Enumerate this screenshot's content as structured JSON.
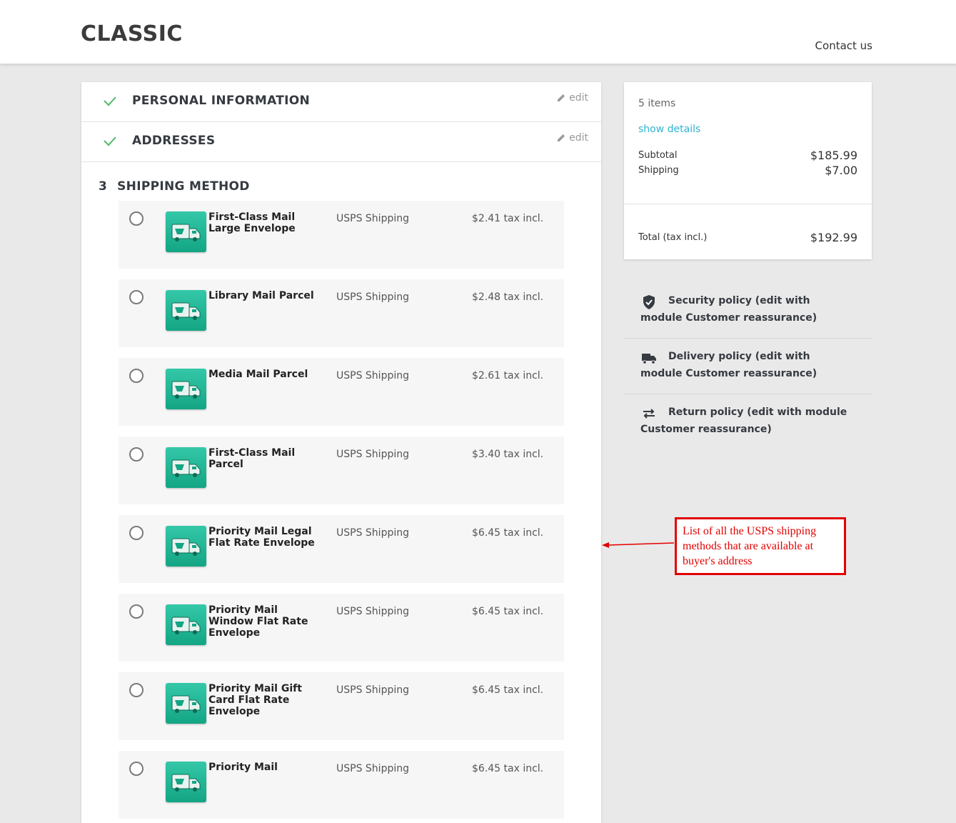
{
  "header": {
    "logo": "CLASSIC",
    "contact": "Contact us"
  },
  "steps": {
    "personal": {
      "title": "PERSONAL INFORMATION",
      "edit": "edit"
    },
    "addresses": {
      "title": "ADDRESSES",
      "edit": "edit"
    },
    "shipping": {
      "number": "3",
      "title": "SHIPPING METHOD"
    }
  },
  "shipping_options": [
    {
      "name": "First-Class Mail Large Envelope",
      "carrier": "USPS Shipping",
      "price": "$2.41 tax incl."
    },
    {
      "name": "Library Mail Parcel",
      "carrier": "USPS Shipping",
      "price": "$2.48 tax incl."
    },
    {
      "name": "Media Mail Parcel",
      "carrier": "USPS Shipping",
      "price": "$2.61 tax incl."
    },
    {
      "name": "First-Class Mail Parcel",
      "carrier": "USPS Shipping",
      "price": "$3.40 tax incl."
    },
    {
      "name": "Priority Mail Legal Flat Rate Envelope",
      "carrier": "USPS Shipping",
      "price": "$6.45 tax incl."
    },
    {
      "name": "Priority Mail Window Flat Rate Envelope",
      "carrier": "USPS Shipping",
      "price": "$6.45 tax incl."
    },
    {
      "name": "Priority Mail Gift Card Flat Rate Envelope",
      "carrier": "USPS Shipping",
      "price": "$6.45 tax incl."
    },
    {
      "name": "Priority Mail",
      "carrier": "USPS Shipping",
      "price": "$6.45 tax incl."
    }
  ],
  "summary": {
    "items": "5 items",
    "show_details": "show details",
    "subtotal_label": "Subtotal",
    "subtotal_value": "$185.99",
    "shipping_label": "Shipping",
    "shipping_value": "$7.00",
    "total_label": "Total (tax incl.)",
    "total_value": "$192.99"
  },
  "reassurance": [
    {
      "icon": "shield-check-icon",
      "text": "Security policy (edit with module Customer reassurance)"
    },
    {
      "icon": "truck-icon",
      "text": "Delivery policy (edit with module Customer reassurance)"
    },
    {
      "icon": "swap-arrows-icon",
      "text": "Return policy (edit with module Customer reassurance)"
    }
  ],
  "annotation": {
    "text": "List of all the USPS shipping methods that are available at buyer's address"
  },
  "colors": {
    "accent": "#2fb5d2",
    "check": "#4cbb6c",
    "annotation": "#e30000",
    "usps_green": "#13a584"
  }
}
